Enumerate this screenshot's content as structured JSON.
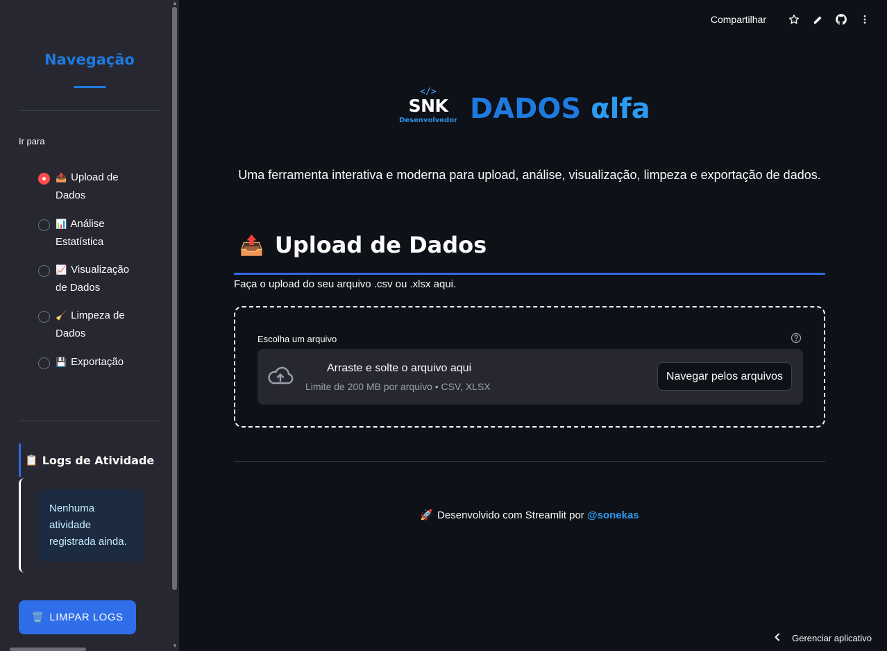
{
  "sidebar": {
    "title": "Navegação",
    "goto_label": "Ir para",
    "nav_items": [
      {
        "emoji": "📤",
        "label": "Upload de Dados",
        "selected": true
      },
      {
        "emoji": "📊",
        "label": "Análise Estatística",
        "selected": false
      },
      {
        "emoji": "📈",
        "label": "Visualização de Dados",
        "selected": false
      },
      {
        "emoji": "🧹",
        "label": "Limpeza de Dados",
        "selected": false
      },
      {
        "emoji": "💾",
        "label": "Exportação",
        "selected": false
      }
    ],
    "logs_title_emoji": "📋",
    "logs_title": "Logs de Atividade",
    "logs_empty": "Nenhuma atividade registrada ainda.",
    "clear_button_emoji": "🗑️",
    "clear_button_label": "LIMPAR LOGS"
  },
  "toolbar": {
    "share_label": "Compartilhar",
    "icons": [
      "star-icon",
      "edit-icon",
      "github-icon",
      "more-icon"
    ]
  },
  "header": {
    "logo_code": "</>",
    "logo_text": "SNK",
    "logo_subtext": "Desenvolvedor",
    "brand_main": "DADOS ",
    "brand_accent": "αlfa",
    "tagline": "Uma ferramenta interativa e moderna para upload, análise, visualização, limpeza e exportação de dados."
  },
  "upload": {
    "section_emoji": "📤",
    "section_title": "Upload de Dados",
    "description": "Faça o upload do seu arquivo .csv ou .xlsx aqui.",
    "file_label": "Escolha um arquivo",
    "dropzone_text": "Arraste e solte o arquivo aqui",
    "dropzone_limit": "Limite de 200 MB por arquivo • CSV, XLSX",
    "browse_label": "Navegar pelos arquivos"
  },
  "footer": {
    "emoji": "🚀",
    "text": "Desenvolvido com Streamlit por ",
    "author": "@sonekas"
  },
  "manage_app": {
    "label": "Gerenciar aplicativo"
  },
  "colors": {
    "accent_blue": "#1f7ae0",
    "radio_selected": "#ff4b4b",
    "background": "#0e1117",
    "sidebar": "#262730"
  }
}
